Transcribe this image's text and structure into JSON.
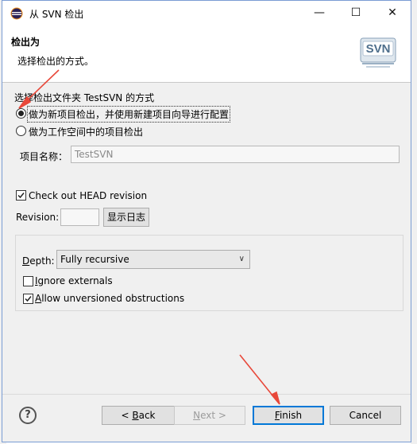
{
  "window": {
    "title": "从 SVN 检出",
    "buttons": [
      "minimize",
      "maximize",
      "close"
    ]
  },
  "header": {
    "title": "检出为",
    "description": "选择检出的方式。",
    "logo_text": "SVN"
  },
  "checkout": {
    "folder_label": "选择检出文件夹 TestSVN 的方式",
    "options": [
      {
        "label": "做为新项目检出，并使用新建项目向导进行配置",
        "selected": true
      },
      {
        "label": "做为工作空间中的项目检出",
        "selected": false
      }
    ],
    "project_name_label": "项目名称：",
    "project_name_value": "TestSVN"
  },
  "revision": {
    "head_label": "Check out HEAD revision",
    "head_checked": true,
    "revision_label": "Revision:",
    "revision_value": "",
    "show_log_label": "显示日志"
  },
  "options_group": {
    "depth_label": "Depth:",
    "depth_value": "Fully recursive",
    "ignore_externals_label": "Ignore externals",
    "ignore_externals_checked": false,
    "allow_unversioned_label": "Allow unversioned obstructions",
    "allow_unversioned_checked": true
  },
  "footer": {
    "help_symbol": "?",
    "back_label": "< Back",
    "next_label": "Next >",
    "finish_label": "Finish",
    "cancel_label": "Cancel"
  },
  "colors": {
    "accent": "#0078d7",
    "annotation_arrow": "#e8483a"
  }
}
